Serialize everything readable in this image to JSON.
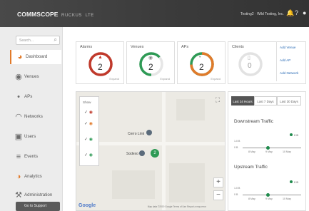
{
  "header": {
    "brand": "COMMSCOPE",
    "product": "RUCKUS",
    "product_suffix": "LTE",
    "account": "Testing2 · Wild Testing, Inc.",
    "accent": "#e17a2a"
  },
  "sidebar": {
    "search_placeholder": "Search...",
    "items": [
      {
        "label": "Dashboard",
        "icon": "dashboard-icon",
        "active": true
      },
      {
        "label": "Venues",
        "icon": "location-pin-icon",
        "active": false
      },
      {
        "label": "APs",
        "icon": "access-point-icon",
        "active": false
      },
      {
        "label": "Networks",
        "icon": "wifi-icon",
        "active": false
      },
      {
        "label": "Users",
        "icon": "users-icon",
        "active": false
      },
      {
        "label": "Events",
        "icon": "events-icon",
        "active": false
      },
      {
        "label": "Analytics",
        "icon": "analytics-icon",
        "active": false
      },
      {
        "label": "Administration",
        "icon": "wrench-icon",
        "active": false
      }
    ],
    "bottom_button": "Go to Support"
  },
  "cards": {
    "alarms": {
      "title": "Alarms",
      "value": "2",
      "footer": "Expand",
      "color": "#c0392b"
    },
    "venues": {
      "title": "Venues",
      "value": "2",
      "footer": "Expand",
      "color": "#2e9a55"
    },
    "aps": {
      "title": "APs",
      "value": "2",
      "footer": "Expand",
      "color": "#e17a2a"
    },
    "clients": {
      "title": "Clients",
      "value": "0"
    }
  },
  "quick_links": [
    "Add Venue",
    "Add AP",
    "Add Network"
  ],
  "map": {
    "legend_title": "Show",
    "legend_rows": [
      "✓",
      "✓",
      "✓",
      "✓"
    ],
    "labels": [
      "Cerro Link",
      "Sodexo"
    ],
    "cluster_count": "2",
    "google": "Google",
    "attribution": "Map data ©2019 Google   Terms of Use   Report a map error",
    "zoom_in": "+",
    "zoom_out": "−"
  },
  "traffic": {
    "tabs": [
      "Last 24 Hours",
      "Last 7 Days",
      "Last 30 Days"
    ],
    "downstream": {
      "title": "Downstream Traffic",
      "legend_value": "0 B",
      "y_labels": [
        "1.0 B",
        "0 B"
      ],
      "x_labels": [
        "8 May",
        "9 May",
        "10 May"
      ]
    },
    "upstream": {
      "title": "Upstream Traffic",
      "legend_value": "0 B",
      "y_labels": [
        "1.0 B",
        "0 B"
      ],
      "x_labels": [
        "8 May",
        "9 May",
        "10 May"
      ]
    }
  }
}
